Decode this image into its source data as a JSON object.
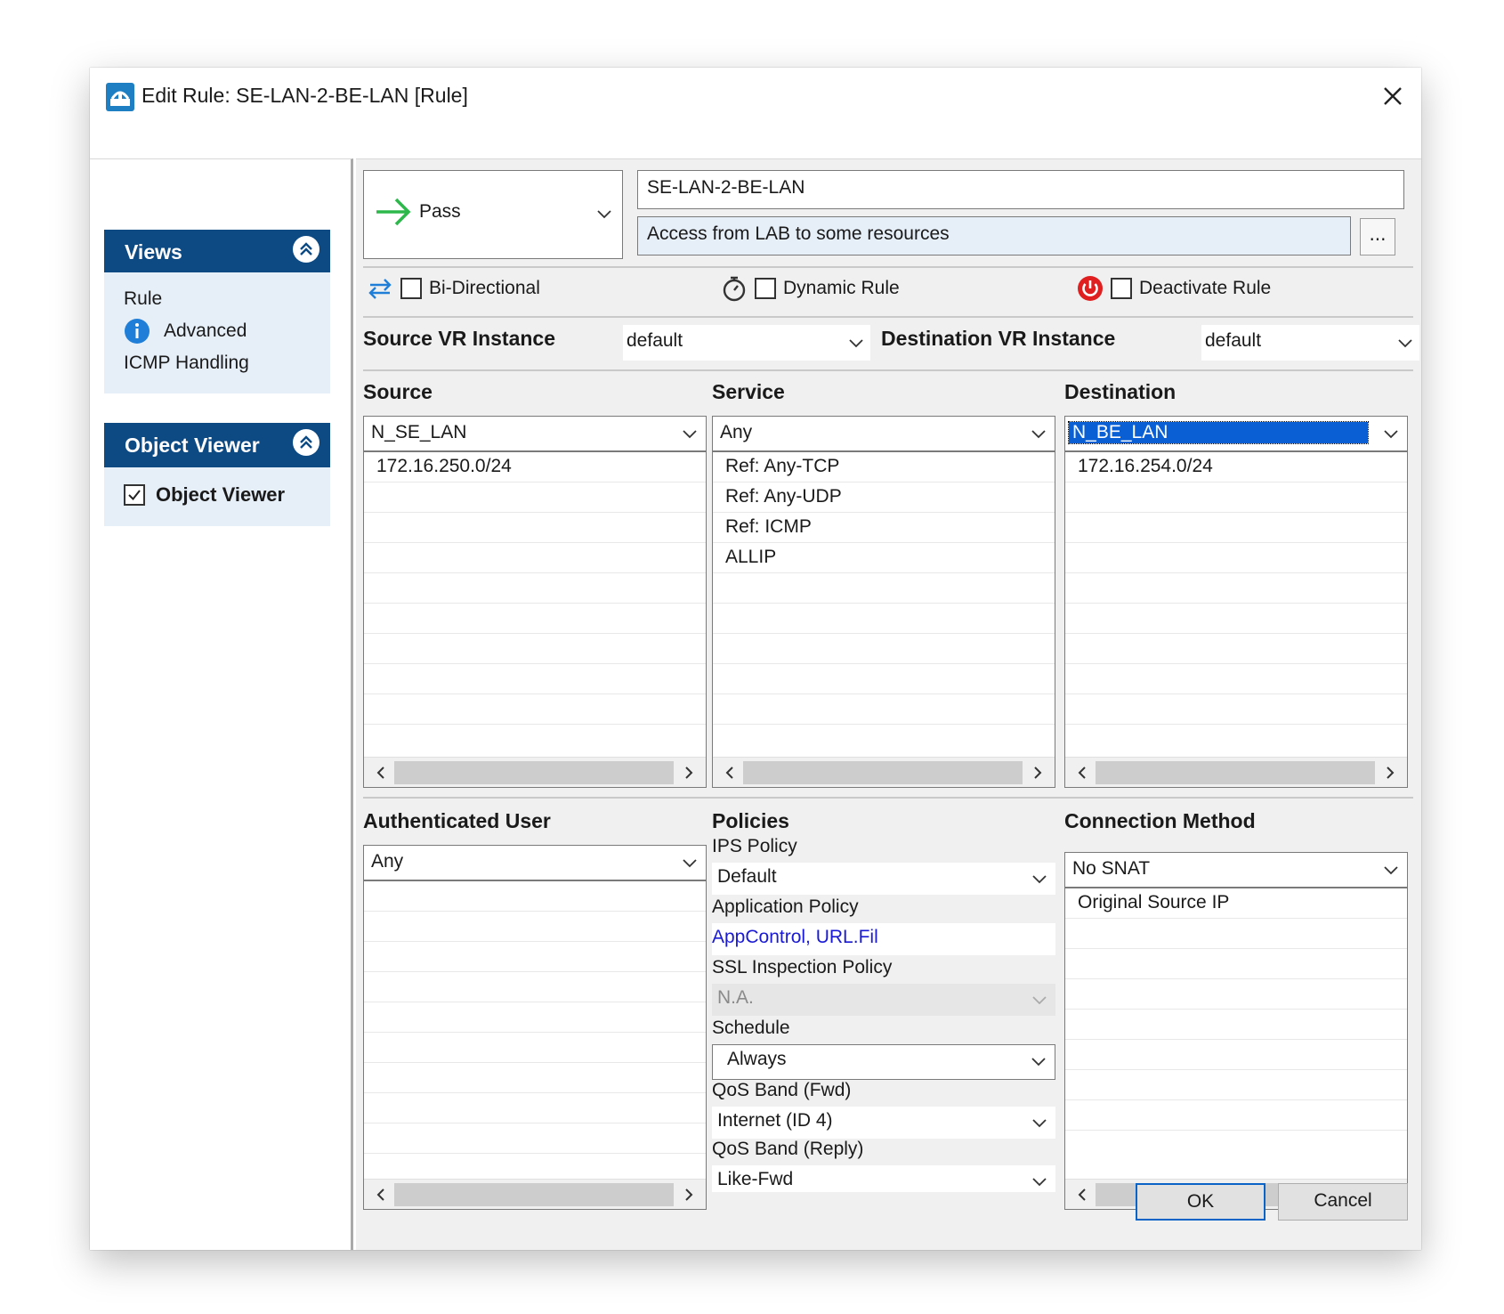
{
  "window": {
    "title": "Edit Rule: SE-LAN-2-BE-LAN [Rule]"
  },
  "sidebar": {
    "views": {
      "heading": "Views",
      "items": [
        "Rule",
        "Advanced",
        "ICMP Handling"
      ]
    },
    "object_viewer": {
      "heading": "Object Viewer",
      "checkbox_label": "Object Viewer",
      "checked": true
    }
  },
  "rule": {
    "action": "Pass",
    "name": "SE-LAN-2-BE-LAN",
    "comment": "Access from LAB to some resources",
    "more_label": "...",
    "flags": {
      "bidirectional": "Bi-Directional",
      "dynamic": "Dynamic Rule",
      "deactivate": "Deactivate Rule"
    },
    "source_vr": {
      "label": "Source VR Instance",
      "value": "default"
    },
    "destination_vr": {
      "label": "Destination VR Instance",
      "value": "default"
    }
  },
  "source": {
    "label": "Source",
    "selected": "N_SE_LAN",
    "items": [
      "172.16.250.0/24"
    ]
  },
  "service": {
    "label": "Service",
    "selected": "Any",
    "items": [
      "Ref: Any-TCP",
      "Ref: Any-UDP",
      "Ref: ICMP",
      "ALLIP"
    ]
  },
  "destination": {
    "label": "Destination",
    "selected": "N_BE_LAN",
    "items": [
      "172.16.254.0/24"
    ]
  },
  "auth_user": {
    "label": "Authenticated User",
    "selected": "Any"
  },
  "policies": {
    "label": "Policies",
    "ips_label": "IPS Policy",
    "ips_value": "Default",
    "app_label": "Application Policy",
    "app_value": "AppControl, URL.Fil",
    "ssl_label": "SSL Inspection Policy",
    "ssl_value": "N.A.",
    "schedule_label": "Schedule",
    "schedule_value": "Always",
    "qos_fwd_label": "QoS Band (Fwd)",
    "qos_fwd_value": "Internet (ID 4)",
    "qos_reply_label": "QoS Band (Reply)",
    "qos_reply_value": "Like-Fwd"
  },
  "connection": {
    "label": "Connection Method",
    "selected": "No SNAT",
    "items": [
      "Original Source IP"
    ]
  },
  "buttons": {
    "ok": "OK",
    "cancel": "Cancel"
  },
  "colors": {
    "panel_header": "#0d4a84",
    "selection": "#0a5fd4",
    "pass_arrow": "#2db84b",
    "deactivate_icon": "#e02020",
    "link": "#1a1ad4"
  }
}
